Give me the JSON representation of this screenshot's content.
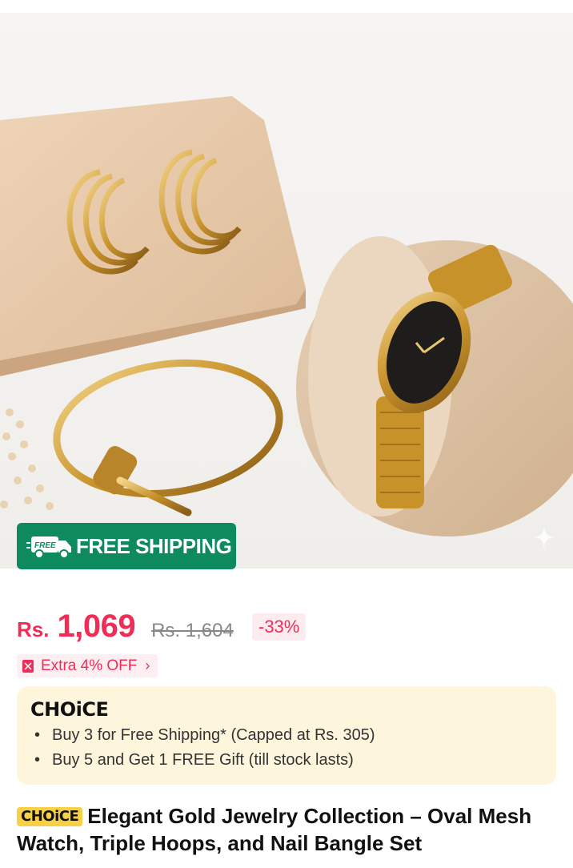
{
  "hero": {
    "image_alt": "Gold hoop earrings, nail bangle and oval mesh watch on display stands",
    "free_shipping_label": "FREE SHIPPING",
    "truck_badge": "FREE"
  },
  "price": {
    "currency": "Rs.",
    "current": "1,069",
    "original": "Rs. 1,604",
    "discount": "-33%"
  },
  "coupon": {
    "label": "Extra 4% OFF"
  },
  "choice": {
    "logo": "CHOiCE",
    "benefits": [
      "Buy 3 for  Free Shipping* (Capped at Rs. 305)",
      "Buy 5 and Get 1 FREE Gift (till stock lasts)"
    ]
  },
  "product": {
    "badge": "CHOiCE",
    "title": "Elegant Gold Jewelry Collection – Oval Mesh Watch, Triple Hoops, and Nail Bangle Set"
  },
  "colors": {
    "accent_red": "#ef2d56",
    "shipping_green": "#0e8a5f",
    "choice_bg": "#fdf6dc",
    "choice_badge": "#f7d046",
    "gold": "#d4a53a"
  }
}
